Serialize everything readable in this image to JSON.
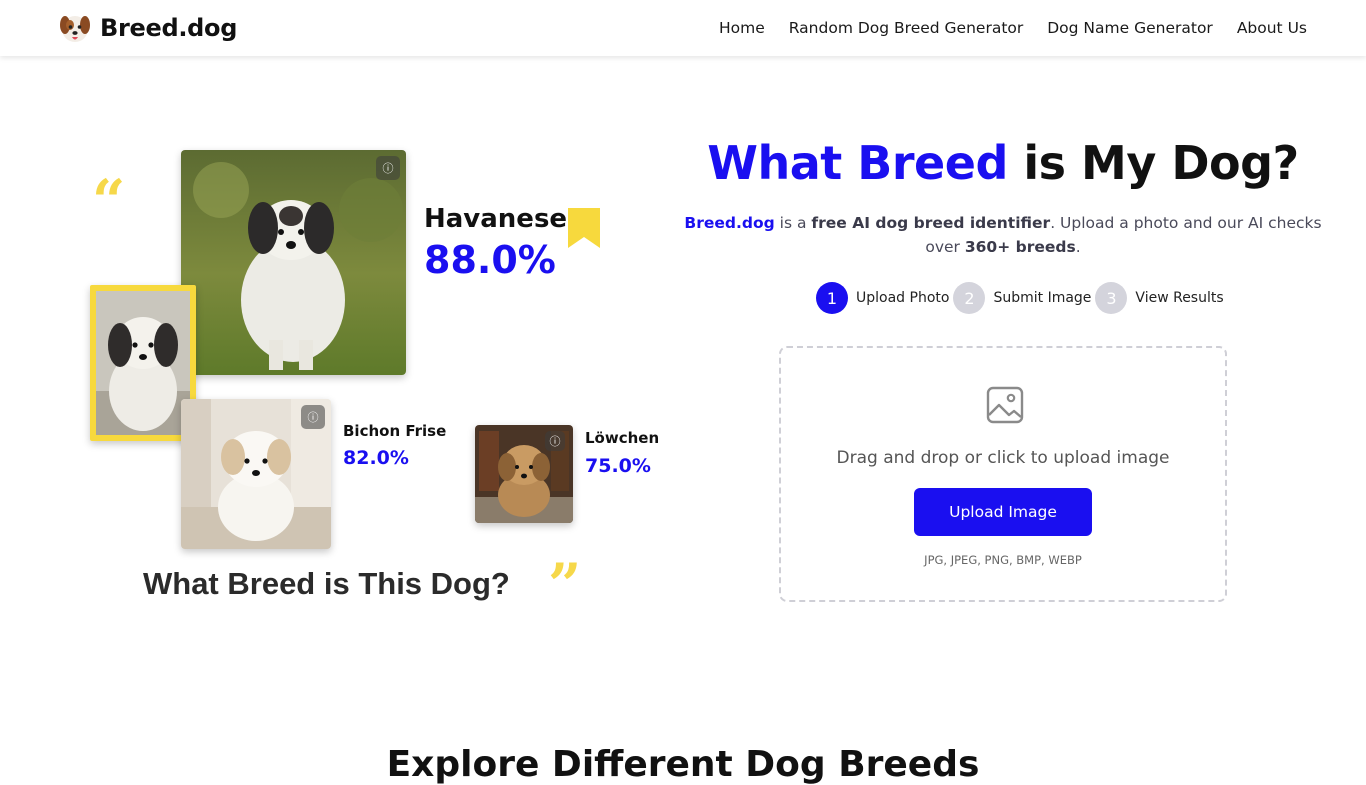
{
  "header": {
    "brand": "Breed.dog",
    "nav": [
      "Home",
      "Random Dog Breed Generator",
      "Dog Name Generator",
      "About Us"
    ]
  },
  "collage": {
    "main_result": {
      "breed": "Havanese",
      "percent": "88.0%"
    },
    "second_result": {
      "breed": "Bichon Frise",
      "percent": "82.0%"
    },
    "third_result": {
      "breed": "Löwchen",
      "percent": "75.0%"
    },
    "caption": "What Breed is This Dog?",
    "quote_open": "“",
    "quote_close": "”",
    "info_icon": "ⓘ"
  },
  "hero": {
    "title_accent": "What Breed",
    "title_rest": " is My Dog?",
    "desc": {
      "brand": "Breed.dog",
      "t1": " is a ",
      "bold1": "free AI dog breed identifier",
      "t2": ". Upload a photo and our AI checks over ",
      "bold2": "360+ breeds",
      "t3": "."
    },
    "steps": [
      {
        "num": "1",
        "label": "Upload Photo"
      },
      {
        "num": "2",
        "label": "Submit Image"
      },
      {
        "num": "3",
        "label": "View Results"
      }
    ]
  },
  "upload": {
    "prompt": "Drag and drop or click to upload image",
    "button": "Upload Image",
    "formats": "JPG, JPEG, PNG, BMP, WEBP"
  },
  "next_section": {
    "title": "Explore Different Dog Breeds"
  },
  "colors": {
    "accent": "#1a0ff0",
    "yellow": "#f7d93d"
  }
}
